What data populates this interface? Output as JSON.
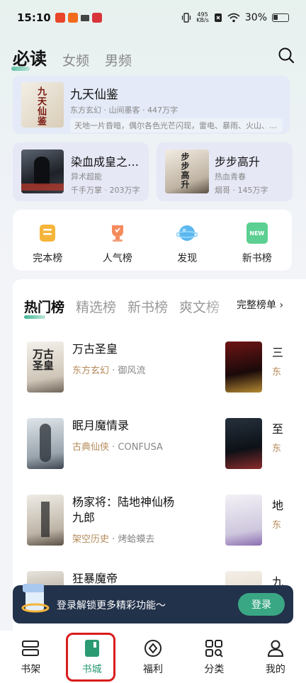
{
  "status": {
    "time": "15:10",
    "net_speed_top": "495",
    "net_speed_bottom": "KB/s",
    "battery": "30%"
  },
  "top_tabs": [
    "必读",
    "女频",
    "男频"
  ],
  "featured": {
    "title": "九天仙鉴",
    "meta": "东方玄幻 · 山间墨客 · 447万字",
    "desc": "天地一片昏暗，偶尔各色光芒闪现，雷电、暴雨、火山、沙漠……",
    "cover_text": "九天仙鉴"
  },
  "mini_cards": [
    {
      "title": "染血成皇之…",
      "genre": "异术超能",
      "meta": "千手万掌 · 203万字"
    },
    {
      "title": "步步高升",
      "genre": "热血青春",
      "meta": "烟哥 · 145万字",
      "cover_text": "步步高升"
    }
  ],
  "quick_links": [
    "完本榜",
    "人气榜",
    "发现",
    "新书榜"
  ],
  "new_badge": "NEW",
  "rank_tabs": [
    "热门榜",
    "精选榜",
    "新书榜",
    "爽文榜"
  ],
  "full_rank": "完整榜单",
  "books": [
    {
      "title": "万古圣皇",
      "genre": "东方玄幻",
      "author": "御风流"
    },
    {
      "title": "眠月魔情录",
      "genre": "古典仙侠",
      "author": "CONFUSA"
    },
    {
      "title": "杨家将：陆地神仙杨九郎",
      "genre": "架空历史",
      "author": "烤蛤蟆去"
    },
    {
      "title": "狂暴魔帝",
      "genre": "",
      "author": ""
    }
  ],
  "side_books": [
    {
      "title": "三",
      "genre": "东"
    },
    {
      "title": "至",
      "genre": "东"
    },
    {
      "title": "地",
      "genre": "东"
    },
    {
      "title": "九",
      "genre": ""
    }
  ],
  "login": {
    "text": "登录解锁更多精彩功能～",
    "button": "登录"
  },
  "nav": [
    "书架",
    "书城",
    "福利",
    "分类",
    "我的"
  ],
  "colors": {
    "accent": "#2a9a72",
    "banner": "#22324a",
    "highlight": "#d91c1c"
  }
}
